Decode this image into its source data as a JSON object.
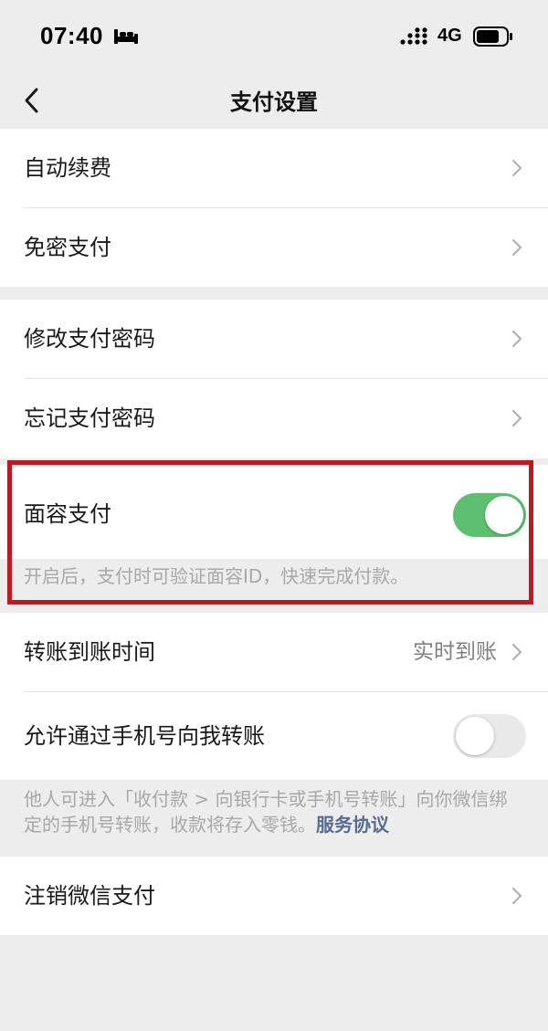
{
  "status_bar": {
    "time": "07:40",
    "network": "4G",
    "icons": [
      "bed-icon",
      "signal-icon",
      "battery-icon"
    ]
  },
  "nav": {
    "title": "支付设置",
    "back_icon": "chevron-left-icon"
  },
  "group1": [
    {
      "label": "自动续费"
    },
    {
      "label": "免密支付"
    }
  ],
  "group2": [
    {
      "label": "修改支付密码"
    },
    {
      "label": "忘记支付密码"
    }
  ],
  "face_pay": {
    "label": "面容支付",
    "enabled": true,
    "tip": "开启后，支付时可验证面容ID，快速完成付款。"
  },
  "transfer_time": {
    "label": "转账到账时间",
    "value": "实时到账"
  },
  "phone_transfer": {
    "label": "允许通过手机号向我转账",
    "enabled": false,
    "tip_text": "他人可进入「收付款 > 向银行卡或手机号转账」向你微信绑定的手机号转账，收款将存入零钱。",
    "tip_link": "服务协议"
  },
  "deregister": {
    "label": "注销微信支付"
  },
  "colors": {
    "accent_green": "#5cc070",
    "link_blue": "#576b95",
    "highlight_red": "#c4161c",
    "background": "#ededed"
  }
}
